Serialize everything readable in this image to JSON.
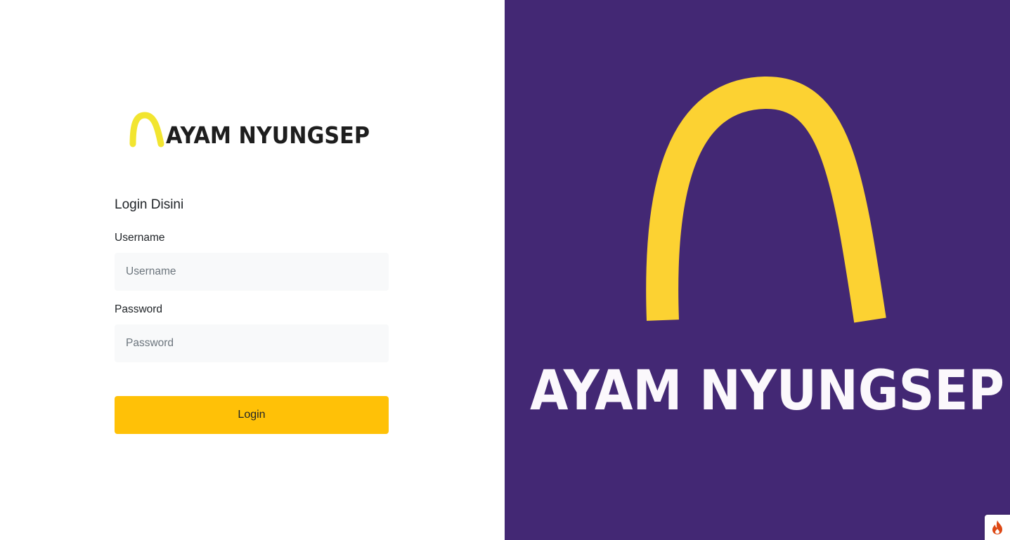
{
  "brand": {
    "logo_icon": "arch-logo-icon",
    "name": "AYAM NYUNGSEP"
  },
  "login_form": {
    "title": "Login Disini",
    "username_label": "Username",
    "username_placeholder": "Username",
    "username_value": "",
    "password_label": "Password",
    "password_placeholder": "Password",
    "password_value": "",
    "submit_label": "Login"
  },
  "hero": {
    "logo_icon": "arch-logo-icon",
    "name": "AYAM NYUNGSEP"
  },
  "debug_toolbar": {
    "icon": "flame-icon"
  },
  "colors": {
    "accent_yellow": "#ffc107",
    "logo_yellow": "#fcd232",
    "hero_background": "#432874",
    "input_background": "#f8f9fa",
    "logo_text_dark": "#1e1e1e",
    "hero_text": "#fbf8fc"
  }
}
